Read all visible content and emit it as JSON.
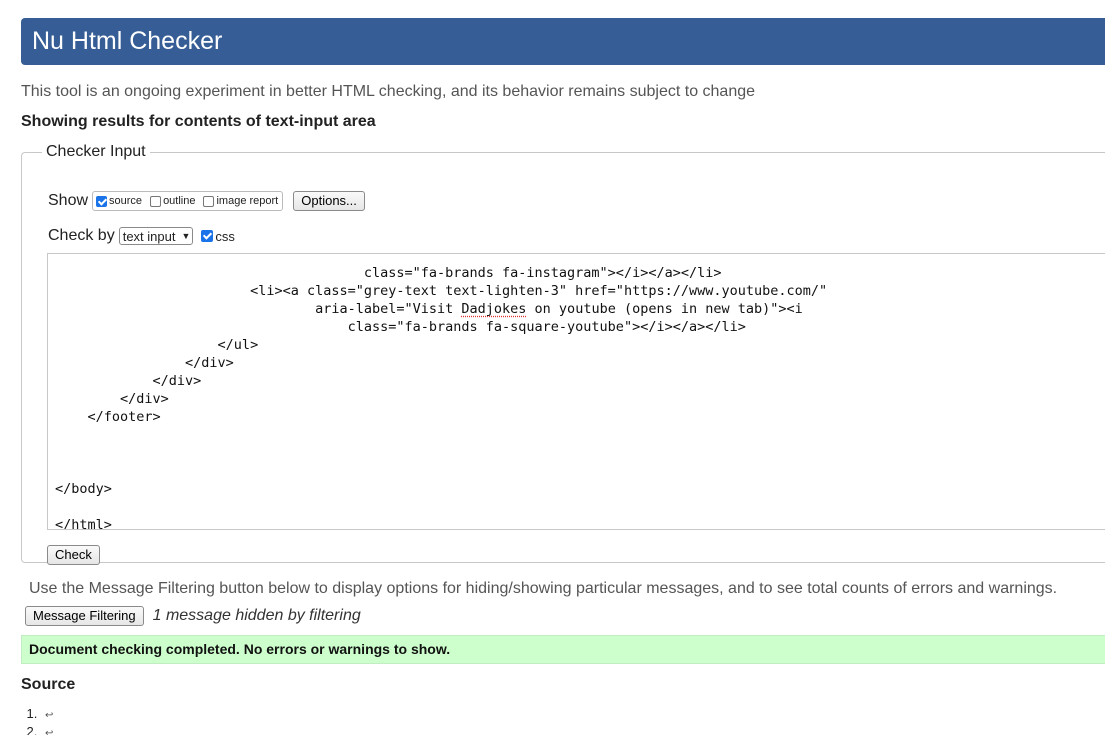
{
  "header": {
    "title": "Nu Html Checker"
  },
  "intro": "This tool is an ongoing experiment in better HTML checking, and its behavior remains subject to change",
  "results_heading": "Showing results for contents of text-input area",
  "checker": {
    "legend": "Checker Input",
    "show_label": "Show",
    "show_options": [
      {
        "label": "source",
        "checked": true
      },
      {
        "label": "outline",
        "checked": false
      },
      {
        "label": "image report",
        "checked": false
      }
    ],
    "options_button": "Options...",
    "check_by_label": "Check by",
    "check_by_value": "text input",
    "css_label": "css",
    "css_checked": true,
    "code_lines": [
      "                                      class=\"fa-brands fa-instagram\"></i></a></li>",
      "                        <li><a class=\"grey-text text-lighten-3\" href=\"https://www.youtube.com/\"",
      "                                aria-label=\"Visit Dadjokes on youtube (opens in new tab)\"><i",
      "                                    class=\"fa-brands fa-square-youtube\"></i></a></li>",
      "                    </ul>",
      "                </div>",
      "            </div>",
      "        </div>",
      "    </footer>",
      "",
      "",
      "",
      "</body>",
      "",
      "</html>"
    ],
    "check_button": "Check"
  },
  "filter_note": "Use the Message Filtering button below to display options for hiding/showing particular messages, and to see total counts of errors and warnings.",
  "message_filtering_button": "Message Filtering",
  "hidden_note": "1 message hidden by filtering",
  "success_message": "Document checking completed. No errors or warnings to show.",
  "source": {
    "heading": "Source",
    "lines": [
      "↩",
      "↩"
    ]
  },
  "colors": {
    "header_bg": "#365d95",
    "success_bg": "#ccffcc",
    "checkbox_accent": "#1a73e8"
  }
}
